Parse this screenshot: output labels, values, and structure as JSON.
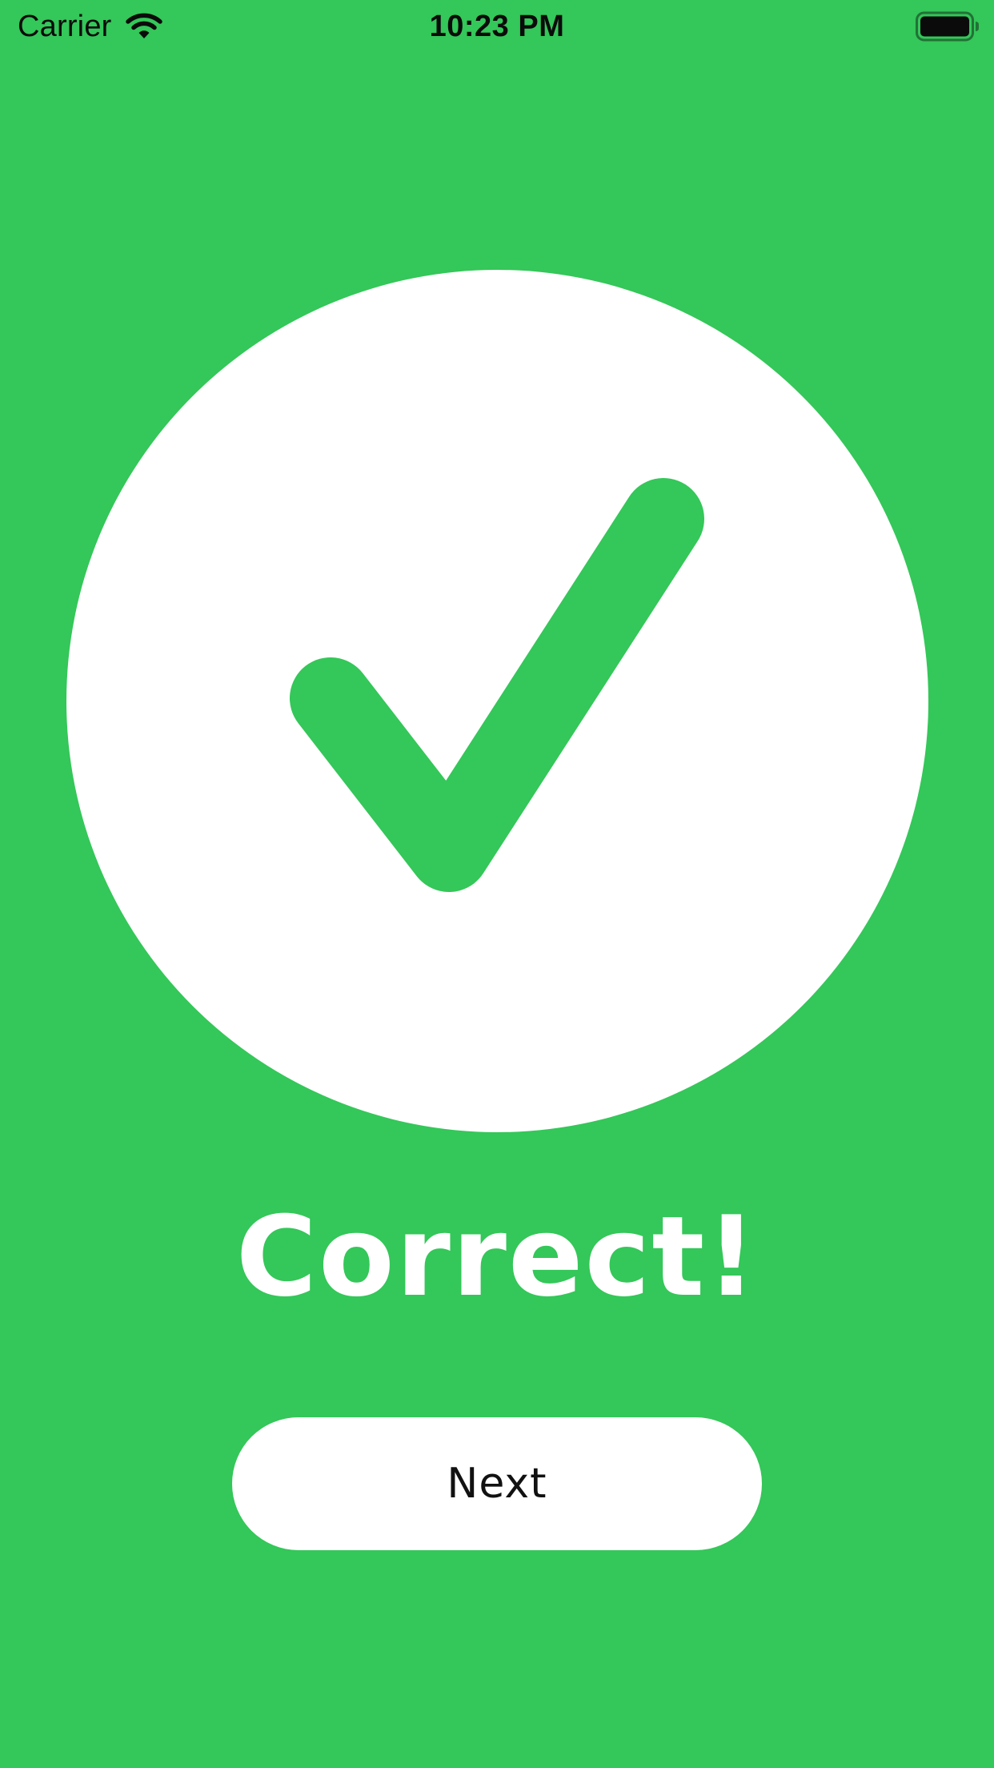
{
  "status_bar": {
    "carrier": "Carrier",
    "time": "10:23 PM",
    "wifi_icon": "wifi-icon",
    "battery_icon": "battery-full-icon"
  },
  "result": {
    "icon": "checkmark-icon",
    "title": "Correct!"
  },
  "actions": {
    "next_label": "Next"
  },
  "colors": {
    "background": "#34c759",
    "circle": "#ffffff",
    "checkmark": "#34c759",
    "title_text": "#ffffff",
    "button_bg": "#ffffff",
    "button_text": "#111111"
  }
}
